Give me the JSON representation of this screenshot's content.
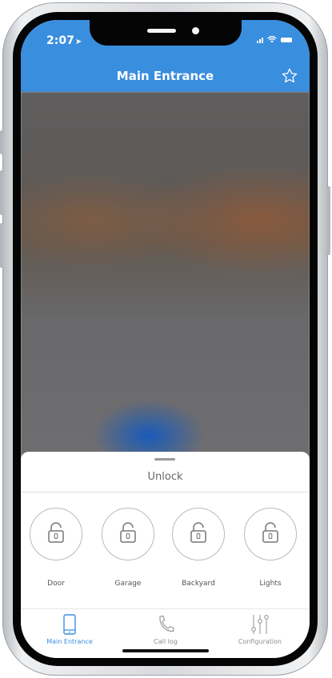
{
  "status_bar": {
    "time": "2:07"
  },
  "header": {
    "title": "Main Entrance"
  },
  "sheet": {
    "title": "Unlock",
    "locks": [
      {
        "label": "Door",
        "icon": "padlock-icon"
      },
      {
        "label": "Garage",
        "icon": "padlock-icon"
      },
      {
        "label": "Backyard",
        "icon": "padlock-icon"
      },
      {
        "label": "Lights",
        "icon": "padlock-icon"
      }
    ]
  },
  "tabs": [
    {
      "label": "Main Entrance",
      "icon": "phone-device-icon",
      "active": true
    },
    {
      "label": "Call log",
      "icon": "phone-handset-icon",
      "active": false
    },
    {
      "label": "Configuration",
      "icon": "sliders-icon",
      "active": false
    }
  ],
  "colors": {
    "accent": "#3a8ede"
  }
}
